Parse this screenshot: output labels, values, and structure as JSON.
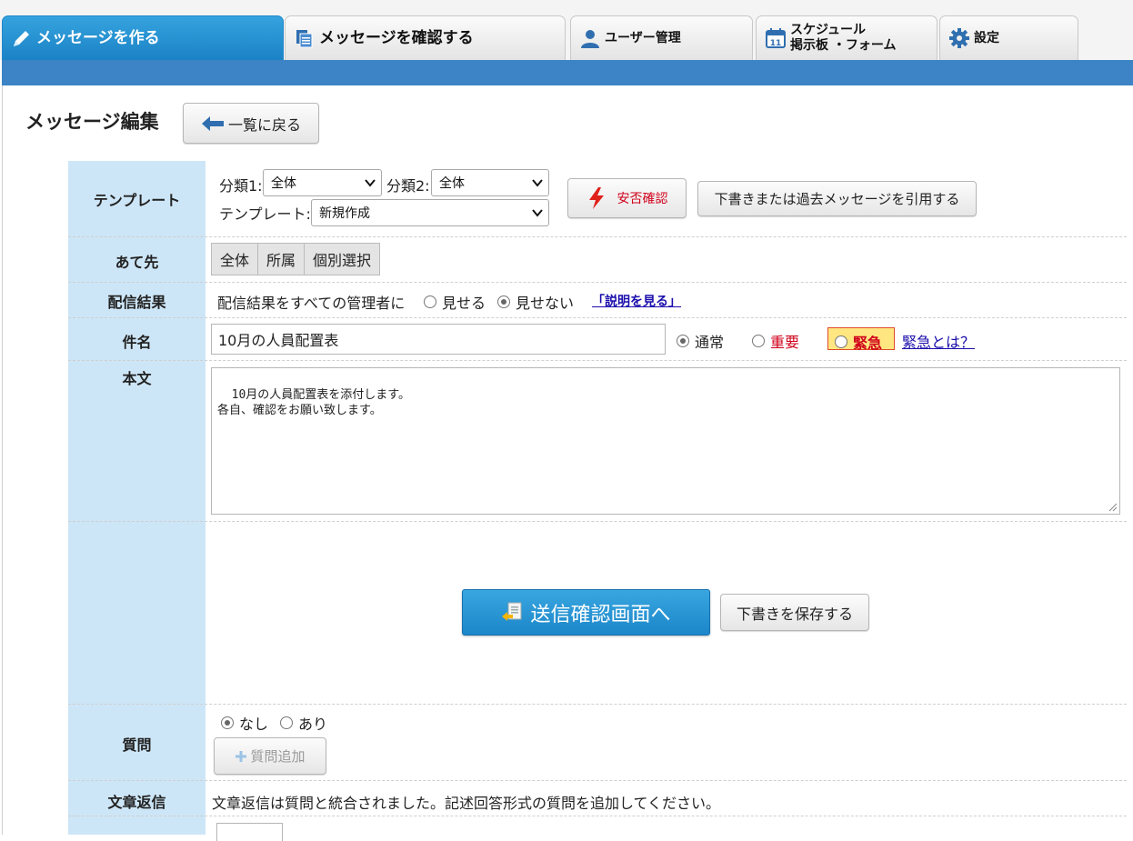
{
  "tabs": [
    {
      "label": "メッセージを作る",
      "icon": "pencil-icon",
      "active": true
    },
    {
      "label": "メッセージを確認する",
      "icon": "documents-icon"
    },
    {
      "label": "ユーザー管理",
      "icon": "user-icon"
    },
    {
      "label_line1": "スケジュール",
      "label_line2": "掲示板 ・フォーム",
      "icon": "calendar-icon",
      "calendar_day": "11"
    },
    {
      "label": "設定",
      "icon": "gear-icon"
    }
  ],
  "page": {
    "title": "メッセージ編集",
    "back_button": "一覧に戻る"
  },
  "template_row": {
    "label": "テンプレート",
    "cat1_label": "分類1:",
    "cat1_value": "全体",
    "cat2_label": "分類2:",
    "cat2_value": "全体",
    "template_label": "テンプレート:",
    "template_value": "新規作成",
    "safety_button": "安否確認",
    "cite_button": "下書きまたは過去メッセージを引用する"
  },
  "recipient_row": {
    "label": "あて先",
    "options": [
      "全体",
      "所属",
      "個別選択"
    ]
  },
  "result_row": {
    "label": "配信結果",
    "text": "配信結果をすべての管理者に",
    "show": "見せる",
    "hide": "見せない",
    "help_link": "「説明を見る」"
  },
  "subject_row": {
    "label": "件名",
    "value": "10月の人員配置表",
    "normal": "通常",
    "important": "重要",
    "urgent": "緊急",
    "urgent_help": "緊急とは？"
  },
  "body_row": {
    "label": "本文",
    "text": "10月の人員配置表を添付します。\n各自、確認をお願い致します。"
  },
  "actions": {
    "send": "送信確認画面へ",
    "save_draft": "下書きを保存する"
  },
  "question_row": {
    "label": "質問",
    "none": "なし",
    "yes": "あり",
    "add_button": "質問追加"
  },
  "reply_row": {
    "label": "文章返信",
    "text": "文章返信は質問と統合されました。記述回答形式の質問を追加してください。"
  },
  "colors": {
    "accent": "#1f88cb",
    "header_strip": "#3c84c5",
    "label_column": "#cde6f7",
    "urgent_bg": "#ffe680",
    "important_text": "#d0021b"
  }
}
